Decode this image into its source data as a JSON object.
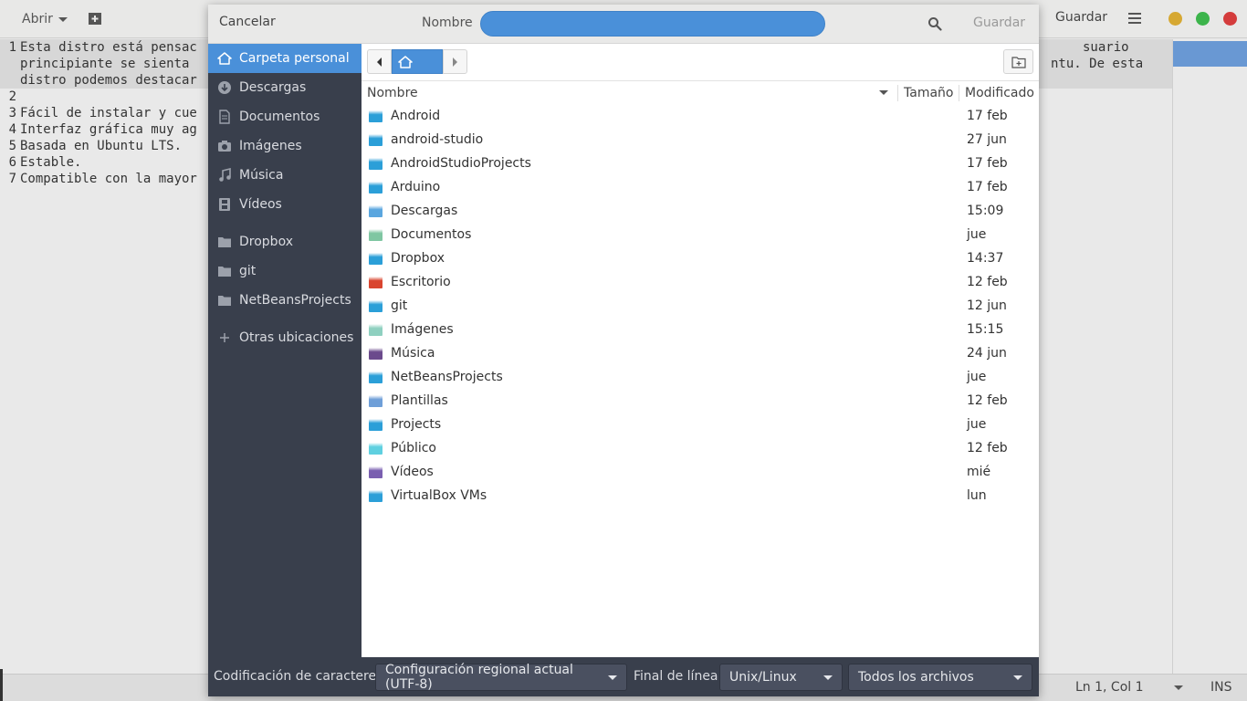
{
  "editor_window": {
    "headerbar": {
      "open_label": "Abrir",
      "new_doc_icon": "new-document-icon",
      "save_label": "Guardar",
      "menu_icon": "hamburger-menu-icon",
      "window_buttons": [
        "minimize",
        "maximize",
        "close"
      ],
      "window_button_colors": {
        "minimize": "#d6a832",
        "maximize": "#3cb44b",
        "close": "#d43c3c"
      }
    },
    "lines": [
      {
        "num": "1",
        "text": "Esta distro está pensac",
        "right_text": "suario"
      },
      {
        "num": "",
        "text": "principiante se sienta",
        "right_text": "ntu. De esta"
      },
      {
        "num": "",
        "text": "distro podemos destacar",
        "right_text": ""
      },
      {
        "num": "2",
        "text": "",
        "right_text": ""
      },
      {
        "num": "3",
        "text": "Fácil de instalar y cue",
        "right_text": ""
      },
      {
        "num": "4",
        "text": "Interfaz gráfica muy ag",
        "right_text": ""
      },
      {
        "num": "5",
        "text": "Basada en Ubuntu LTS.",
        "right_text": ""
      },
      {
        "num": "6",
        "text": "Estable.",
        "right_text": ""
      },
      {
        "num": "7",
        "text": "Compatible con la mayor",
        "right_text": ""
      }
    ],
    "statusbar": {
      "position": "Ln 1, Col 1",
      "mode": "INS"
    }
  },
  "dialog": {
    "header": {
      "cancel_label": "Cancelar",
      "name_label": "Nombre",
      "name_value": "",
      "search_icon": "search-icon",
      "save_label": "Guardar"
    },
    "sidebar": [
      {
        "label": "Carpeta personal",
        "icon": "home-icon",
        "active": true
      },
      {
        "label": "Descargas",
        "icon": "download-icon",
        "active": false
      },
      {
        "label": "Documentos",
        "icon": "document-icon",
        "active": false
      },
      {
        "label": "Imágenes",
        "icon": "camera-icon",
        "active": false
      },
      {
        "label": "Música",
        "icon": "music-note-icon",
        "active": false
      },
      {
        "label": "Vídeos",
        "icon": "film-icon",
        "active": false
      },
      {
        "label": "Dropbox",
        "icon": "folder-icon",
        "active": false
      },
      {
        "label": "git",
        "icon": "folder-icon",
        "active": false
      },
      {
        "label": "NetBeansProjects",
        "icon": "folder-icon",
        "active": false
      },
      {
        "label": "Otras ubicaciones",
        "icon": "plus-icon",
        "active": false
      }
    ],
    "pathbar": {
      "back_icon": "chevron-left-icon",
      "home_icon": "home-icon",
      "forward_icon": "chevron-right-icon",
      "new_folder_icon": "new-folder-icon"
    },
    "columns": {
      "name": "Nombre",
      "size": "Tamaño",
      "modified": "Modificado"
    },
    "files": [
      {
        "name": "Android",
        "modified": "17 feb",
        "color": "#2b9fd8"
      },
      {
        "name": "android-studio",
        "modified": "27 jun",
        "color": "#2b9fd8"
      },
      {
        "name": "AndroidStudioProjects",
        "modified": "17 feb",
        "color": "#2b9fd8"
      },
      {
        "name": "Arduino",
        "modified": "17 feb",
        "color": "#2b9fd8"
      },
      {
        "name": "Descargas",
        "modified": "15:09",
        "color": "#5aa6df"
      },
      {
        "name": "Documentos",
        "modified": "jue",
        "color": "#7fc6a2"
      },
      {
        "name": "Dropbox",
        "modified": "14:37",
        "color": "#2b9fd8"
      },
      {
        "name": "Escritorio",
        "modified": "12 feb",
        "color": "#d9452f"
      },
      {
        "name": "git",
        "modified": "12 jun",
        "color": "#2b9fd8"
      },
      {
        "name": "Imágenes",
        "modified": "15:15",
        "color": "#8fd0c0"
      },
      {
        "name": "Música",
        "modified": "24 jun",
        "color": "#6b4a8c"
      },
      {
        "name": "NetBeansProjects",
        "modified": "jue",
        "color": "#2b9fd8"
      },
      {
        "name": "Plantillas",
        "modified": "12 feb",
        "color": "#6f9fd8"
      },
      {
        "name": "Projects",
        "modified": "jue",
        "color": "#2b9fd8"
      },
      {
        "name": "Público",
        "modified": "12 feb",
        "color": "#5fd0e0"
      },
      {
        "name": "Vídeos",
        "modified": "mié",
        "color": "#7a5fb0"
      },
      {
        "name": "VirtualBox VMs",
        "modified": "lun",
        "color": "#2b9fd8"
      }
    ],
    "footer": {
      "encoding_label": "Codificación de caracteres:",
      "encoding_value": "Configuración regional actual (UTF-8)",
      "line_end_label": "Final de línea:",
      "line_end_value": "Unix/Linux",
      "filter_value": "Todos los archivos"
    }
  }
}
